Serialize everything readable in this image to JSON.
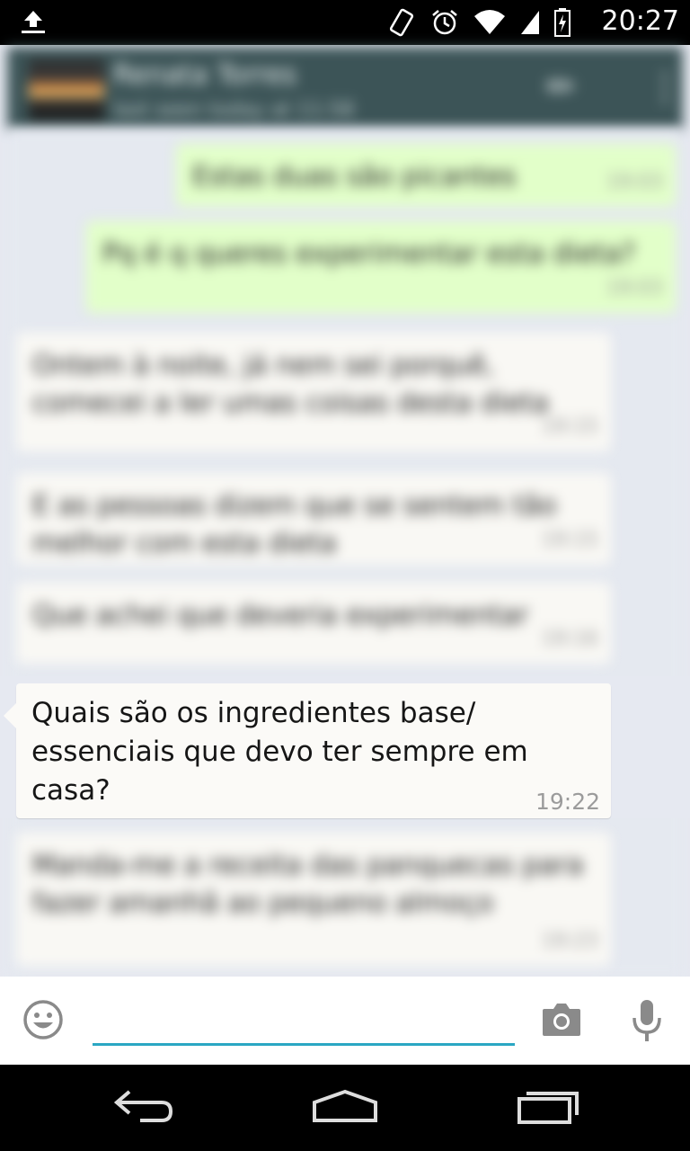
{
  "status_bar": {
    "time": "20:27",
    "icons": [
      "upload-icon",
      "vibrate-icon",
      "alarm-icon",
      "wifi-icon",
      "signal-icon",
      "battery-charging-icon"
    ]
  },
  "header": {
    "contact_name": "Renata Torres",
    "last_seen": "last seen today at 11:58",
    "icons": [
      "avatar",
      "attach-icon",
      "overflow-menu-icon"
    ]
  },
  "messages": [
    {
      "direction": "out",
      "text": "Estas duas são picantes",
      "time": "19:03"
    },
    {
      "direction": "out",
      "text": "Pq é q queres experimentar esta dieta?",
      "time": "19:03"
    },
    {
      "direction": "in",
      "text": "Ontem à noite, já nem sei porquê, comecei a ler umas coisas desta dieta",
      "time": "19:15"
    },
    {
      "direction": "in",
      "text": "E as pessoas dizem que se sentem tão melhor com esta dieta",
      "time": "19:15"
    },
    {
      "direction": "in",
      "text": "Que achei que deveria experimentar",
      "time": "19:16"
    },
    {
      "direction": "in",
      "text": "Quais são os ingredientes base/ essenciais que devo ter sempre em casa?",
      "time": "19:22",
      "focused": true
    },
    {
      "direction": "in",
      "text": "Manda-me a receita das panquecas para fazer amanhã ao pequeno almoço",
      "time": "19:23"
    }
  ],
  "compose": {
    "value": "",
    "placeholder": "",
    "accent_color": "#2aa7c3",
    "icons": [
      "emoji-icon",
      "camera-icon",
      "microphone-icon"
    ]
  },
  "nav_bar": {
    "icons": [
      "back-icon",
      "home-icon",
      "recent-apps-icon"
    ]
  },
  "colors": {
    "header": "#3c5457",
    "chat_background": "#e6e9f1",
    "outgoing_bubble": "#e2ffc9",
    "incoming_bubble": "#fbfaf7"
  }
}
